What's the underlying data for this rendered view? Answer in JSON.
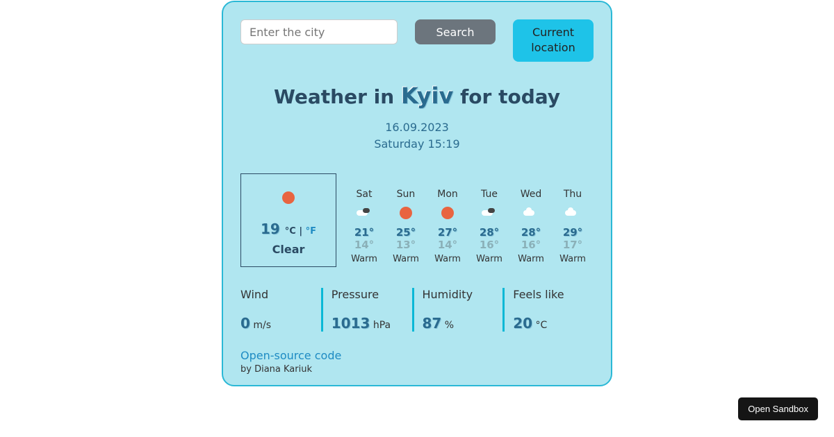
{
  "search": {
    "placeholder": "Enter the city",
    "search_button": "Search",
    "current_location_button": "Current location"
  },
  "title": {
    "prefix": "Weather in ",
    "city": "Kyiv",
    "suffix": " for today"
  },
  "date": {
    "date_str": "16.09.2023",
    "day_time": "Saturday 15:19"
  },
  "today": {
    "temp": "19",
    "unit_selected": "°C",
    "unit_sep": " | ",
    "unit_alt": "°F",
    "desc": "Clear",
    "icon": "sun"
  },
  "forecast": [
    {
      "day": "Sat",
      "icon": "cloud-dark",
      "hi": "21°",
      "lo": "14°",
      "desc": "Warm"
    },
    {
      "day": "Sun",
      "icon": "sun",
      "hi": "25°",
      "lo": "13°",
      "desc": "Warm"
    },
    {
      "day": "Mon",
      "icon": "sun",
      "hi": "27°",
      "lo": "14°",
      "desc": "Warm"
    },
    {
      "day": "Tue",
      "icon": "cloud-dark",
      "hi": "28°",
      "lo": "16°",
      "desc": "Warm"
    },
    {
      "day": "Wed",
      "icon": "cloud",
      "hi": "28°",
      "lo": "16°",
      "desc": "Warm"
    },
    {
      "day": "Thu",
      "icon": "cloud",
      "hi": "29°",
      "lo": "17°",
      "desc": "Warm"
    }
  ],
  "metrics": {
    "wind": {
      "label": "Wind",
      "value": "0",
      "unit": " m/s"
    },
    "pressure": {
      "label": "Pressure",
      "value": "1013",
      "unit": " hPa"
    },
    "humidity": {
      "label": "Humidity",
      "value": "87",
      "unit": " %"
    },
    "feelslike": {
      "label": "Feels like",
      "value": "20",
      "unit": " °C"
    }
  },
  "footer": {
    "link": "Open-source code",
    "author": "by Diana Kariuk"
  },
  "sandbox_button": "Open Sandbox"
}
